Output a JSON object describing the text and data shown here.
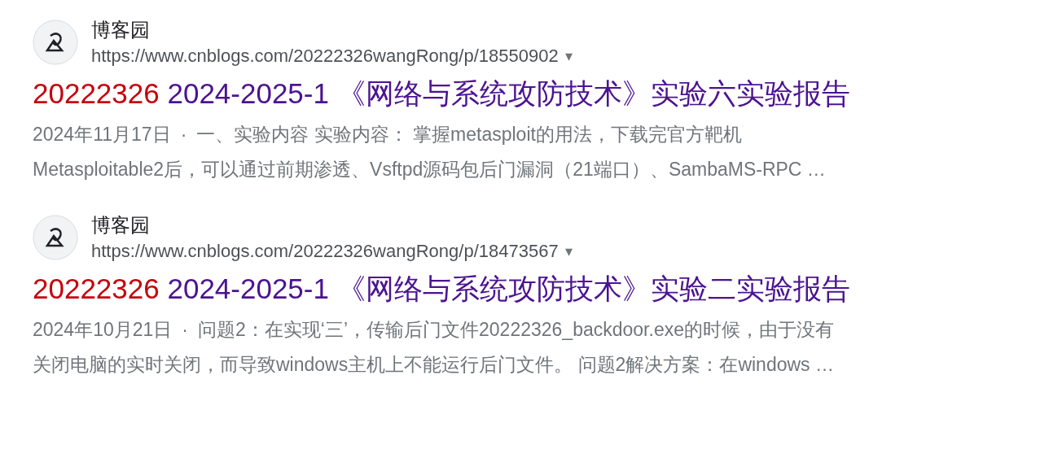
{
  "results": [
    {
      "site_name": "博客园",
      "url": "https://www.cnblogs.com/20222326wangRong/p/18550902",
      "url_menu": "▾",
      "title_parts": [
        {
          "text": "20222326",
          "highlighted": true
        },
        {
          "text": " 2024-2025-1 《网络与系统攻防技术》实验六实验报告",
          "highlighted": false
        }
      ],
      "date": "2024年11月17日",
      "separator": "·",
      "snippet_lines": [
        "一、实验内容 实验内容： 掌握metasploit的用法，下载完官方靶机",
        "Metasploitable2后，可以通过前期渗透、Vsftpd源码包后门漏洞（21端口）、SambaMS-RPC …"
      ]
    },
    {
      "site_name": "博客园",
      "url": "https://www.cnblogs.com/20222326wangRong/p/18473567",
      "url_menu": "▾",
      "title_parts": [
        {
          "text": "20222326",
          "highlighted": true
        },
        {
          "text": " 2024-2025-1 《网络与系统攻防技术》实验二实验报告",
          "highlighted": false
        }
      ],
      "date": "2024年10月21日",
      "separator": "·",
      "snippet_lines": [
        "问题2：在实现‘三’，传输后门文件20222326_backdoor.exe的时候，由于没有",
        "关闭电脑的实时关闭，而导致windows主机上不能运行后门文件。 问题2解决方案：在windows …"
      ]
    }
  ]
}
